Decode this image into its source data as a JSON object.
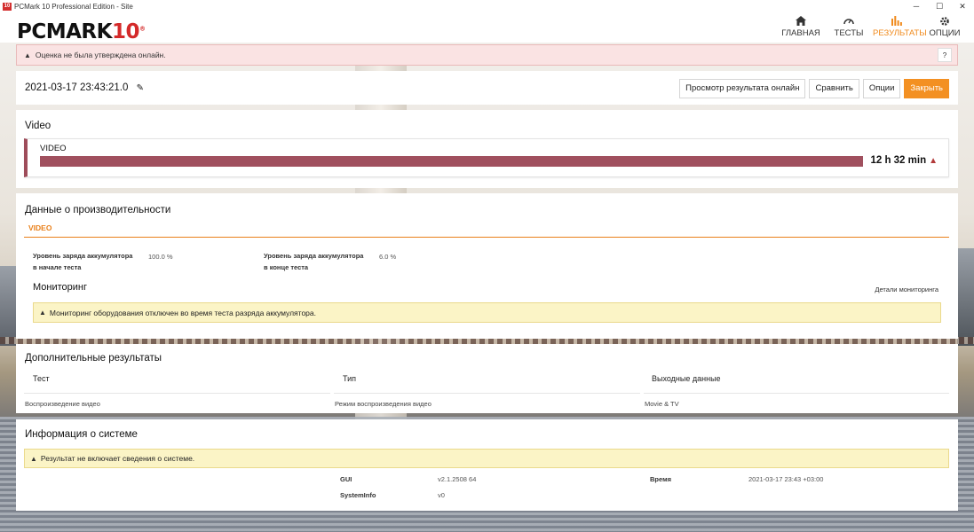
{
  "window": {
    "title": "PCMark 10 Professional Edition - Site",
    "app_icon_text": "10",
    "minimize": "─",
    "maximize": "☐",
    "close": "✕"
  },
  "brand": {
    "logo_main": "PCMARK",
    "logo_ten": "10",
    "logo_reg": "®"
  },
  "nav": [
    {
      "label": "ГЛАВНАЯ",
      "icon": "home-icon"
    },
    {
      "label": "ТЕСТЫ",
      "icon": "gauge-icon"
    },
    {
      "label": "РЕЗУЛЬТАТЫ",
      "icon": "bar-chart-icon",
      "active": true
    },
    {
      "label": "ОПЦИИ",
      "icon": "gear-icon"
    }
  ],
  "banner": {
    "text": "Оценка не была утверждена онлайн.",
    "help": "?"
  },
  "result": {
    "date": "2021-03-17 23:43:21.0",
    "buttons": {
      "view_online": "Просмотр результата онлайн",
      "compare": "Сравнить",
      "options": "Опции",
      "close": "Закрыть"
    }
  },
  "video": {
    "section_title": "Video",
    "label": "VIDEO",
    "value": "12 h 32 min",
    "accent_color": "#a0505e"
  },
  "performance": {
    "title": "Данные о производительности",
    "tab": "VIDEO",
    "battery_start_label_1": "Уровень заряда аккумулятора",
    "battery_start_label_2": "в начале теста",
    "battery_start_value": "100.0 %",
    "battery_end_label_1": "Уровень заряда аккумулятора",
    "battery_end_label_2": "в конце теста",
    "battery_end_value": "6.0 %",
    "monitoring_title": "Мониторинг",
    "monitoring_link": "Детали мониторинга",
    "monitoring_warning": "Мониторинг оборудования отключен во время теста разряда аккумулятора."
  },
  "additional": {
    "title": "Дополнительные результаты",
    "headers": [
      "Тест",
      "Тип",
      "Выходные данные"
    ],
    "row": [
      "Воспроизведение видео",
      "Режим воспроизведения видео",
      "Movie & TV"
    ]
  },
  "system": {
    "title": "Информация о системе",
    "warning": "Результат не включает сведения о системе.",
    "gui_label": "GUI",
    "gui_value": "v2.1.2508 64",
    "time_label": "Время",
    "time_value": "2021-03-17 23:43 +03:00",
    "sysinfo_label": "SystemInfo",
    "sysinfo_value": "v0"
  },
  "colors": {
    "accent_orange": "#f39022",
    "warning_red_bg": "#fae3e3",
    "warning_yellow_bg": "#fbf4c6"
  }
}
